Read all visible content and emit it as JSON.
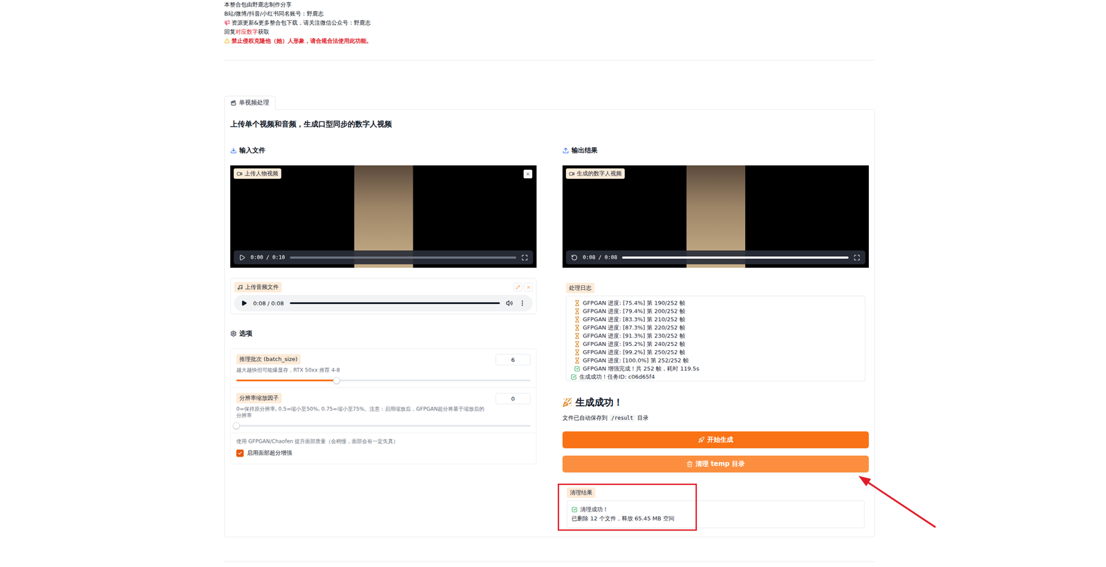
{
  "header": {
    "lines": [
      {
        "kind": "plain",
        "segments": [
          {
            "text": "本整合包由野鹿志制作分享",
            "highlight": false
          }
        ]
      },
      {
        "kind": "plain",
        "segments": [
          {
            "text": "B站/微博/抖音/小红书同名账号：野鹿志",
            "highlight": false
          }
        ]
      },
      {
        "kind": "notice",
        "segments": [
          {
            "text": "资源更新&更多整合包下载，请关注微信公众号：野鹿志",
            "highlight": false
          }
        ]
      },
      {
        "kind": "plain",
        "segments": [
          {
            "text": "回复",
            "highlight": false
          },
          {
            "text": "对应数字",
            "highlight": true
          },
          {
            "text": "获取",
            "highlight": false
          }
        ]
      },
      {
        "kind": "warning",
        "segments": [
          {
            "text": "禁止侵权克隆他（她）人形象，请合规合法使用此功能。",
            "highlight": true
          }
        ]
      }
    ]
  },
  "tabs": [
    {
      "label": "单视频处理",
      "selected": true
    }
  ],
  "description": "上传单个视频和音频，生成口型同步的数字人视频",
  "input": {
    "title": "输入文件",
    "video": {
      "label": "上传人物视频",
      "time": "0:00 / 0:10",
      "level": 0,
      "ended": false
    },
    "audio": {
      "label": "上传音频文件",
      "time": "0:08 / 0:08",
      "level": 1
    }
  },
  "options": {
    "title": "选项",
    "sliders": [
      {
        "label": "推理批次 (batch_size)",
        "hint": "越大越快但可能爆显存，RTX 50xx 推荐 4-8",
        "value": "6",
        "level": 0.34
      },
      {
        "label": "分辨率缩放因子",
        "hint": "0=保持原分辨率, 0.5=缩小至50%, 0.75=缩小至75%。注意：启用缩放后，GFPGAN超分将基于缩放后的分辨率",
        "value": "0",
        "level": 0
      }
    ],
    "checkbox": {
      "hint": "使用 GFPGAN/Chaofen 提升面部质量（会稍慢，面部会有一定失真）",
      "label": "启用面部超分增强",
      "checked": true
    }
  },
  "output": {
    "title": "输出结果",
    "video": {
      "label": "生成的数字人视频",
      "time": "0:08 / 0:08",
      "level": 1,
      "ended": true
    },
    "log": {
      "label": "处理日志",
      "lines": [
        {
          "kind": "progress",
          "text": "GFPGAN 进度: [75.4%] 第 190/252 帧"
        },
        {
          "kind": "progress",
          "text": "GFPGAN 进度: [79.4%] 第 200/252 帧"
        },
        {
          "kind": "progress",
          "text": "GFPGAN 进度: [83.3%] 第 210/252 帧"
        },
        {
          "kind": "progress",
          "text": "GFPGAN 进度: [87.3%] 第 220/252 帧"
        },
        {
          "kind": "progress",
          "text": "GFPGAN 进度: [91.3%] 第 230/252 帧"
        },
        {
          "kind": "progress",
          "text": "GFPGAN 进度: [95.2%] 第 240/252 帧"
        },
        {
          "kind": "progress",
          "text": "GFPGAN 进度: [99.2%] 第 250/252 帧"
        },
        {
          "kind": "progress",
          "text": "GFPGAN 进度: [100.0%] 第 252/252 帧"
        },
        {
          "kind": "done",
          "text": "GFPGAN 增强完成！共 252 帧，耗时 119.5s"
        },
        {
          "kind": "done",
          "text": "生成成功！任务ID: c06d65f4"
        }
      ]
    },
    "success": {
      "title": "生成成功！",
      "before": "文件已自动保存到",
      "code": "/result",
      "after": "目录"
    },
    "buttons": [
      {
        "label": "开始生成",
        "kind": "primary"
      },
      {
        "label": "清理 temp 目录",
        "kind": "secondary"
      }
    ],
    "result": {
      "label": "清理结果",
      "lines": [
        {
          "kind": "done",
          "text": "清理成功！"
        },
        {
          "kind": "plain",
          "text": "已删除 12 个文件，释放 65.45 MB 空间"
        }
      ]
    }
  }
}
